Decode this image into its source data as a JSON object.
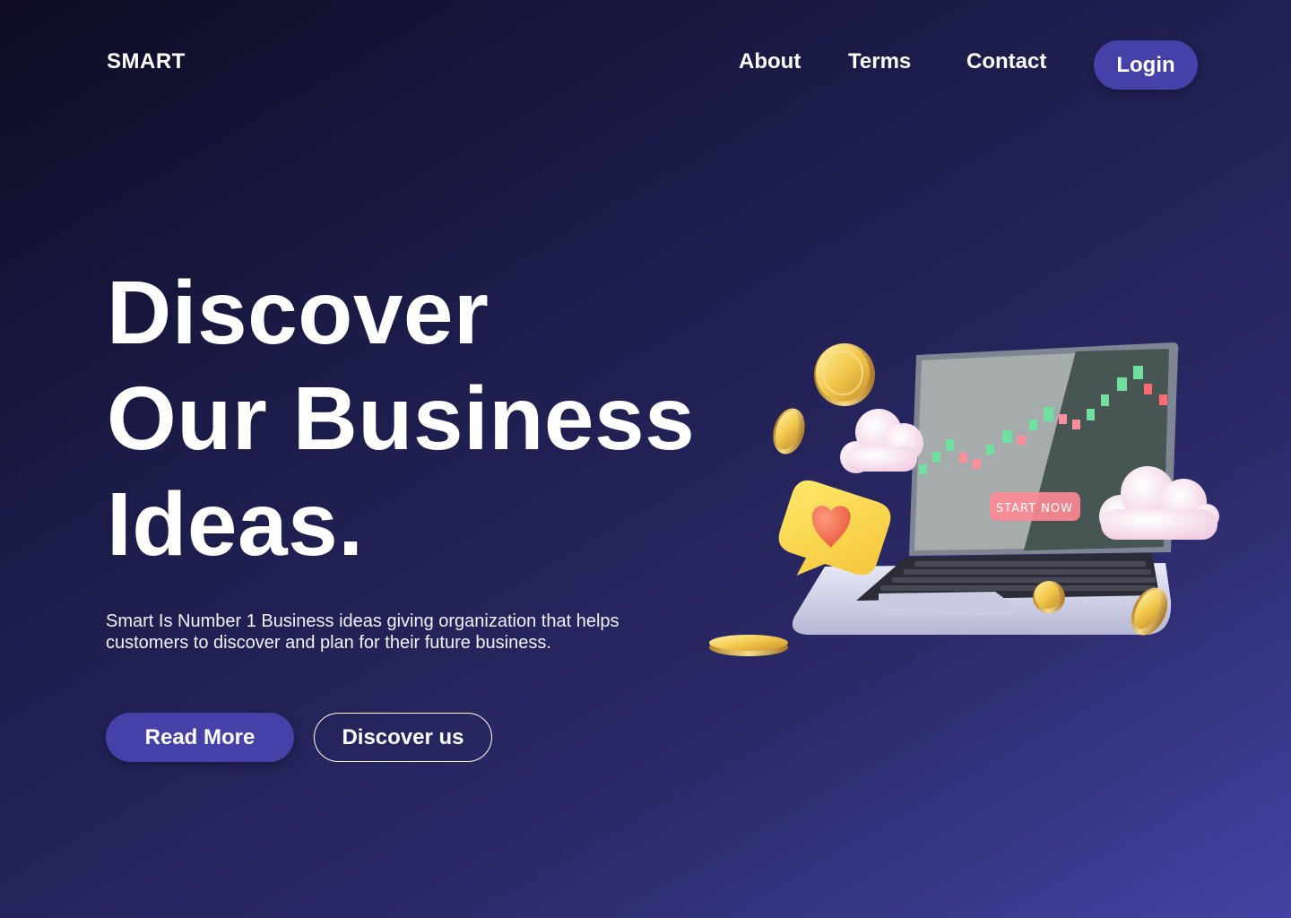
{
  "header": {
    "logo": "SMART",
    "nav": [
      {
        "label": "About"
      },
      {
        "label": "Terms"
      },
      {
        "label": "Contact"
      }
    ],
    "login_label": "Login"
  },
  "hero": {
    "title_lines": [
      "Discover",
      "Our Business",
      "Ideas."
    ],
    "description": "Smart Is Number 1 Business ideas giving organization that helps customers to discover and plan for their future business.",
    "primary_button": "Read More",
    "secondary_button": "Discover us"
  },
  "illustration": {
    "screen_button": "START NOW",
    "icons": [
      "laptop-icon",
      "coin-icon",
      "cloud-icon",
      "heart-icon",
      "candlestick-chart-icon"
    ]
  },
  "colors": {
    "accent": "#4641a8",
    "background_start": "#0d0c24",
    "background_end": "#4343a3"
  }
}
